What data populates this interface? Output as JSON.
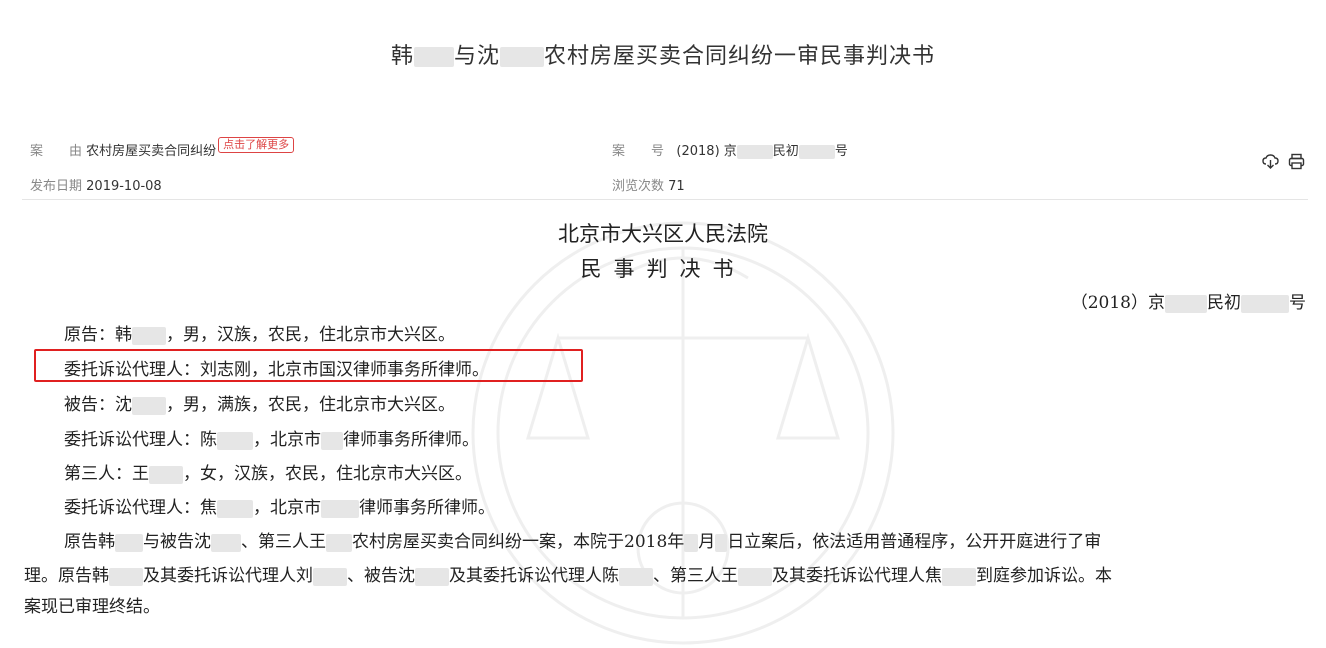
{
  "title": {
    "a": "韩",
    "b": "与沈",
    "c": "农村房屋买卖合同纠纷一审民事判决书"
  },
  "meta": {
    "cause_label": "案　　由",
    "cause_value": "农村房屋买卖合同纠纷",
    "learn_more": "点击了解更多",
    "caseno_label": "案　　号",
    "caseno_a": "(2018) 京",
    "caseno_b": "民初",
    "caseno_c": "号",
    "date_label": "发布日期",
    "date_value": "2019-10-08",
    "views_label": "浏览次数",
    "views_value": "71"
  },
  "icons": {
    "download": "download-icon",
    "print": "print-icon"
  },
  "doc": {
    "court": "北京市大兴区人民法院",
    "type": "民事判决书",
    "caseno_a": "（2018）京",
    "caseno_b": "民初",
    "caseno_c": "号",
    "lines": {
      "l1a": "原告：韩",
      "l1b": "，男，汉族，农民，住北京市大兴区。",
      "l2": "委托诉讼代理人：刘志刚，北京市国汉律师事务所律师。",
      "l3a": "被告：沈",
      "l3b": "，男，满族，农民，住北京市大兴区。",
      "l4a": "委托诉讼代理人：陈",
      "l4b": "，北京市",
      "l4c": "律师事务所律师。",
      "l5a": "第三人：王",
      "l5b": "，女，汉族，农民，住北京市大兴区。",
      "l6a": "委托诉讼代理人：焦",
      "l6b": "，北京市",
      "l6c": "律师事务所律师。",
      "l7a": "原告韩",
      "l7b": "与被告沈",
      "l7c": "、第三人王",
      "l7d": "农村房屋买卖合同纠纷一案，本院于2018年",
      "l7e": "月",
      "l7f": "日立案后，依法适用普通程序，公开开庭进行了审",
      "l8a": "理。原告韩",
      "l8b": "及其委托诉讼代理人刘",
      "l8c": "、被告沈",
      "l8d": "及其委托诉讼代理人陈",
      "l8e": "、第三人王",
      "l8f": "及其委托诉讼代理人焦",
      "l8g": "到庭参加诉讼。本",
      "l9": "案现已审理终结。"
    }
  },
  "colors": {
    "highlight": "#e02020",
    "tag": "#dd4444"
  }
}
